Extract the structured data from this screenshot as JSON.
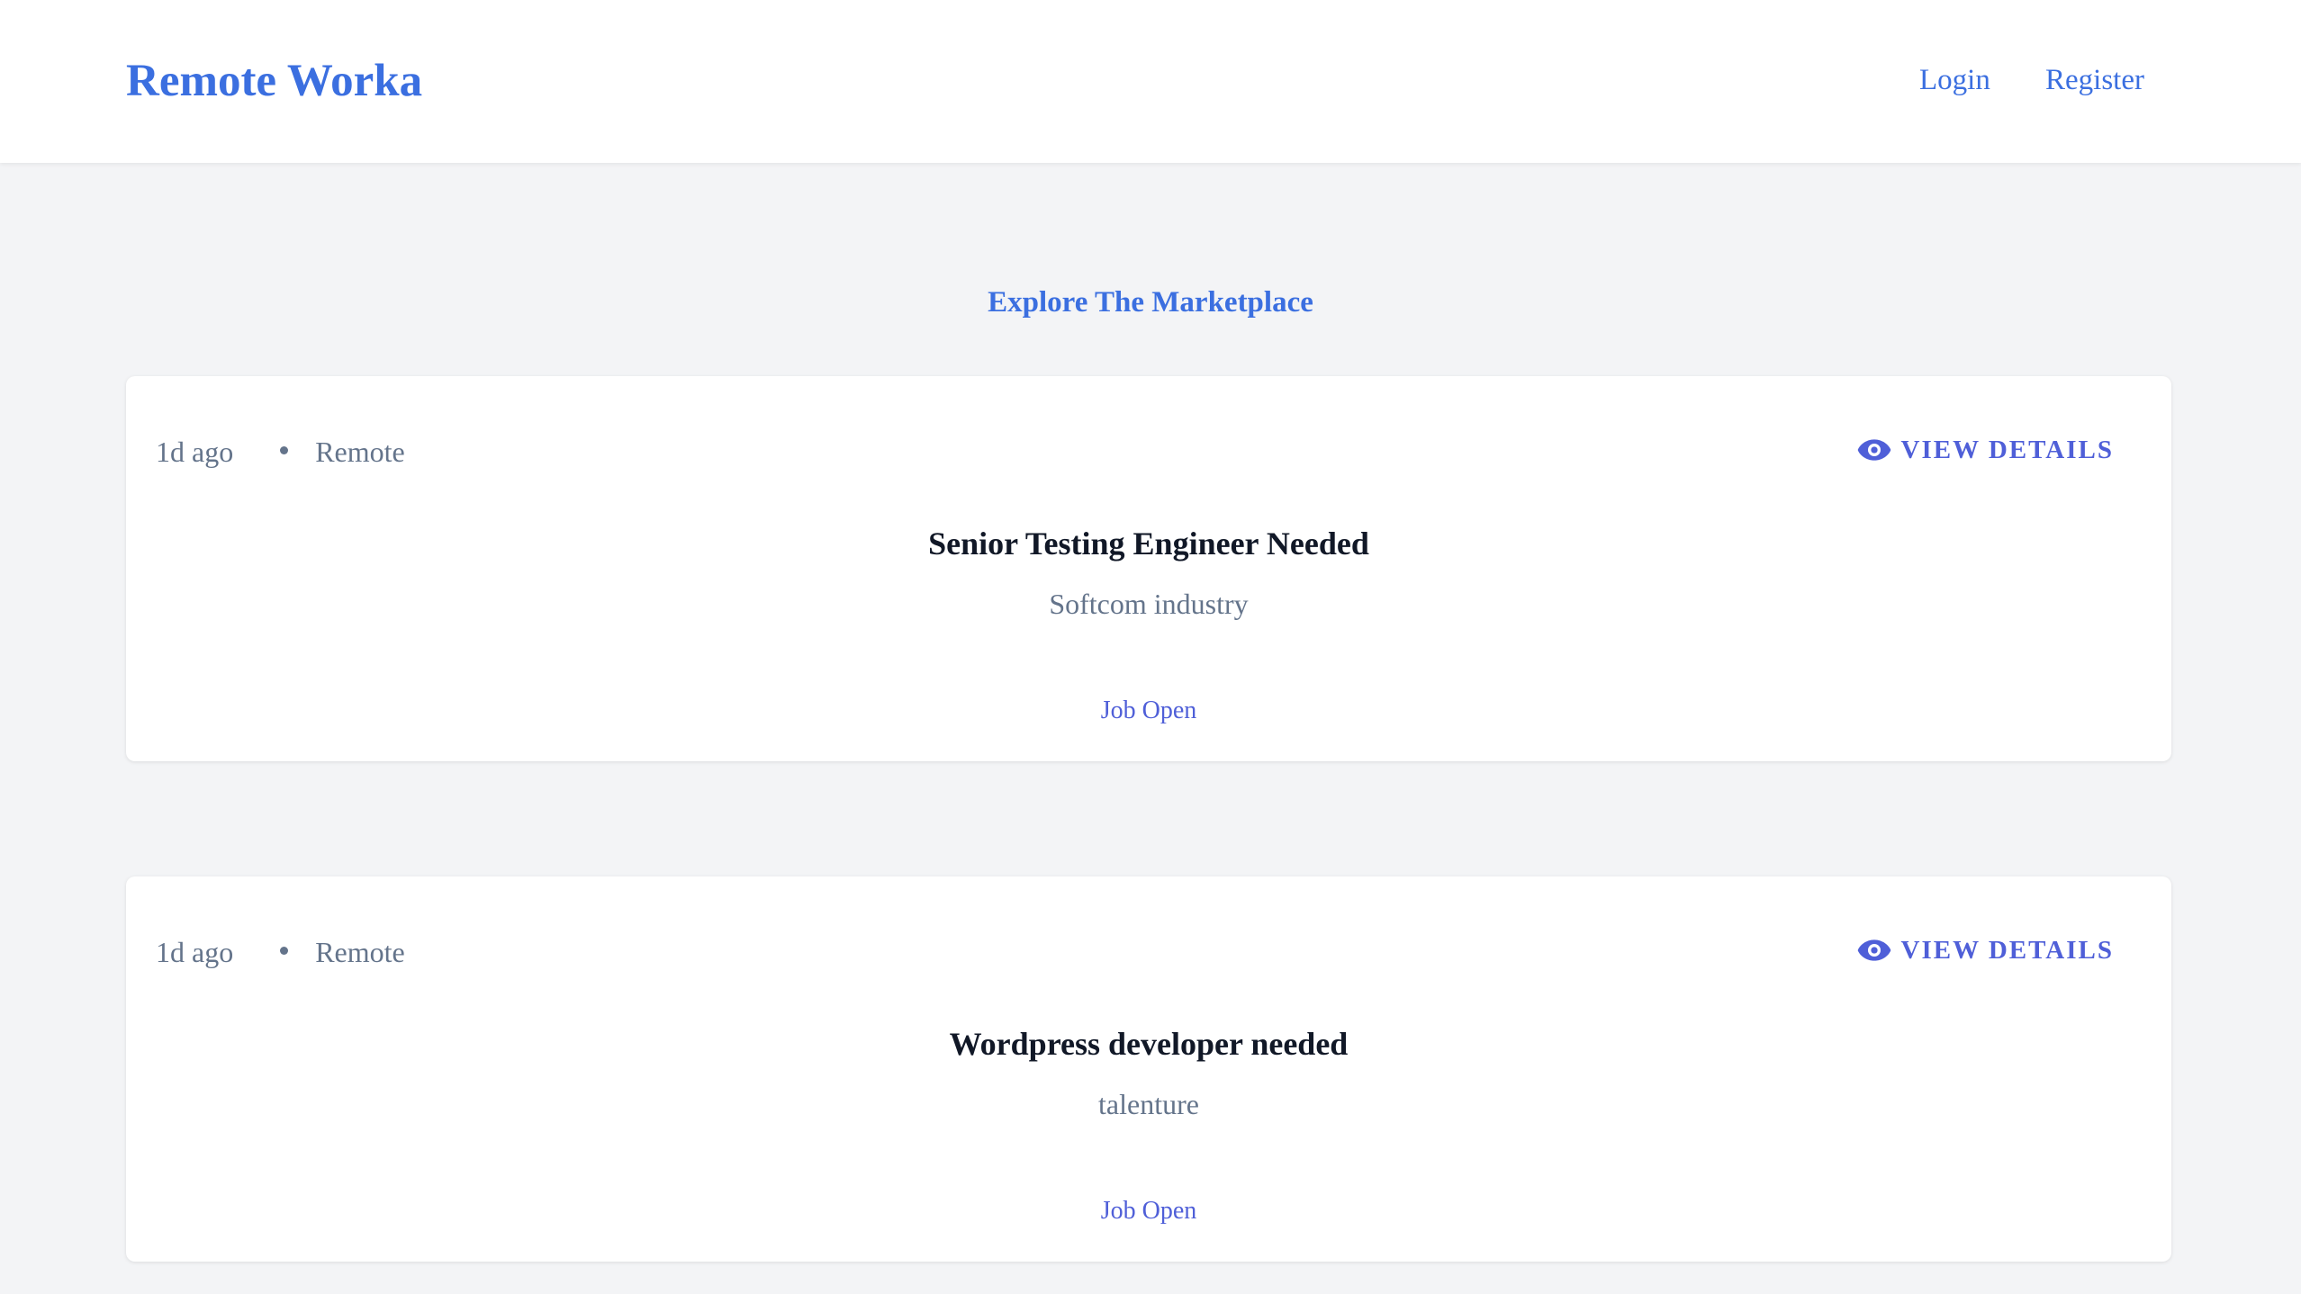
{
  "header": {
    "brand": "Remote Worka",
    "nav": {
      "login": "Login",
      "register": "Register"
    }
  },
  "main": {
    "title": "Explore The Marketplace",
    "jobs": [
      {
        "posted": "1d ago",
        "location": "Remote",
        "action_label": "VIEW DETAILS",
        "title": "Senior Testing Engineer Needed",
        "company": "Softcom industry",
        "status": "Job Open"
      },
      {
        "posted": "1d ago",
        "location": "Remote",
        "action_label": "VIEW DETAILS",
        "title": "Wordpress developer needed",
        "company": "talenture",
        "status": "Job Open"
      }
    ]
  },
  "colors": {
    "brand": "#3b6fe0",
    "accent": "#4f5fd8",
    "muted": "#64748b",
    "background": "#f3f4f6"
  },
  "icons": {
    "view_details": "eye-icon"
  }
}
